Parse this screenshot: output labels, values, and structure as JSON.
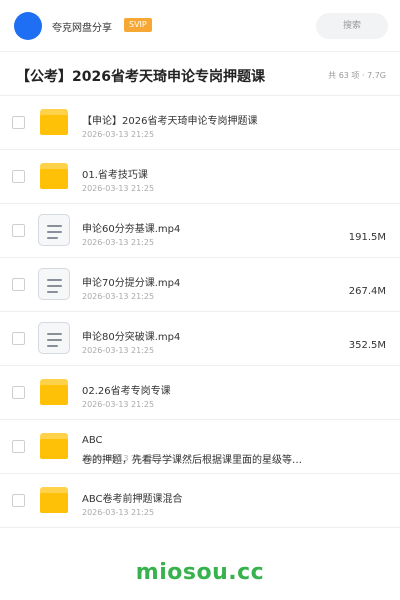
{
  "header": {
    "app_name": "夸克网盘分享",
    "badge": "SVIP",
    "search_placeholder": "搜索",
    "accent": "#1f6ff5",
    "badge_color": "#f7a733"
  },
  "folder": {
    "title": "【公考】2026省考天琦申论专岗押题课",
    "meta": "共 63 项 · 7.7G"
  },
  "items": [
    {
      "type": "folder",
      "icon": "folder-icon",
      "name": "【申论】2026省考天琦申论专岗押题课",
      "date": "2026-03-13 21:25",
      "size": ""
    },
    {
      "type": "folder",
      "icon": "folder-icon",
      "name": "01.省考技巧课",
      "date": "2026-03-13 21:25",
      "size": ""
    },
    {
      "type": "file",
      "icon": "document-icon",
      "name": "申论60分夯基课.mp4",
      "date": "2026-03-13 21:25",
      "size": "191.5M"
    },
    {
      "type": "file",
      "icon": "document-icon",
      "name": "申论70分提分课.mp4",
      "date": "2026-03-13 21:25",
      "size": "267.4M"
    },
    {
      "type": "file",
      "icon": "document-icon",
      "name": "申论80分突破课.mp4",
      "date": "2026-03-13 21:25",
      "size": "352.5M"
    },
    {
      "type": "folder",
      "icon": "folder-icon",
      "name": "02.26省考专岗专课",
      "date": "2026-03-13 21:25",
      "size": ""
    },
    {
      "type": "folder",
      "icon": "folder-icon",
      "name": "ABC",
      "extra": "卷的押题，先看导学课然后根据课里面的星级等…",
      "date": "2026-03-13 21:25",
      "size": ""
    },
    {
      "type": "folder",
      "icon": "folder-icon",
      "name": "ABC卷考前押题课混合",
      "date": "2026-03-13 21:25",
      "size": ""
    }
  ],
  "watermark": "miosou.cc"
}
